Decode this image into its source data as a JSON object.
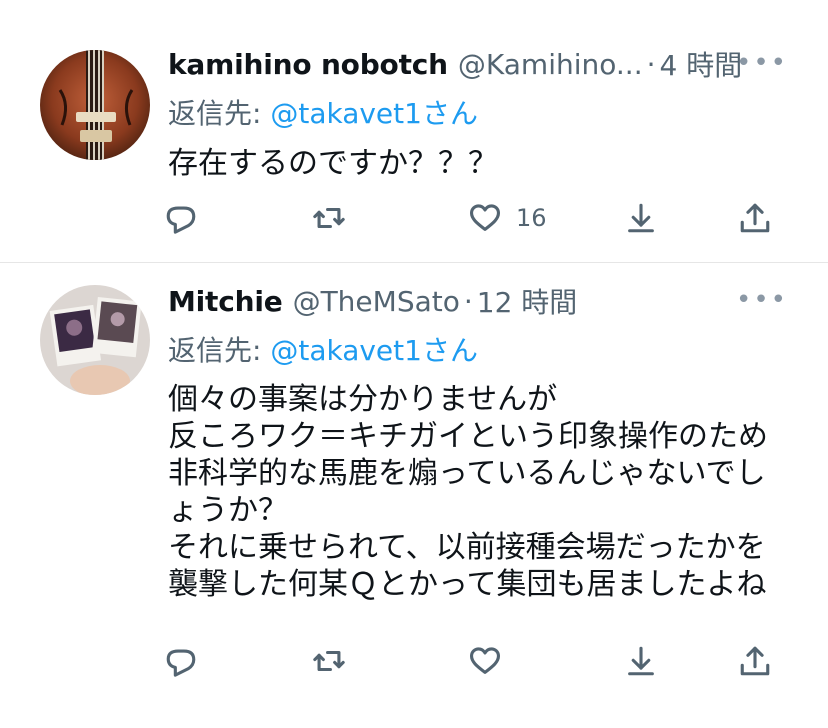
{
  "tweets": [
    {
      "name": "kamihino nobotch",
      "handle": "@Kamihino...",
      "dot": "·",
      "time": "4 時間",
      "more": "•••",
      "reply_prefix": "返信先: ",
      "reply_user": "@takavet1さん",
      "text": "存在するのですか？？？",
      "like_count": "16",
      "avatar_icon": "violin-avatar"
    },
    {
      "name": "Mitchie",
      "handle": "@TheMSato",
      "dot": "·",
      "time": "12 時間",
      "more": "•••",
      "reply_prefix": "返信先: ",
      "reply_user": "@takavet1さん",
      "text": "個々の事案は分かりませんが\n反ころワク＝キチガイという印象操作のため\n非科学的な馬鹿を煽っているんじゃないでし\nょうか？\nそれに乗せられて、以前接種会場だったかを\n襲撃した何某Ｑとかって集団も居ましたよね",
      "like_count": "",
      "avatar_icon": "photos-avatar"
    }
  ],
  "icons": [
    "reply-icon",
    "retweet-icon",
    "like-icon",
    "share-down-icon",
    "upload-icon"
  ],
  "colors": {
    "link": "#1d9bf0",
    "secondary": "#536471",
    "divider": "#e6e6e6"
  }
}
